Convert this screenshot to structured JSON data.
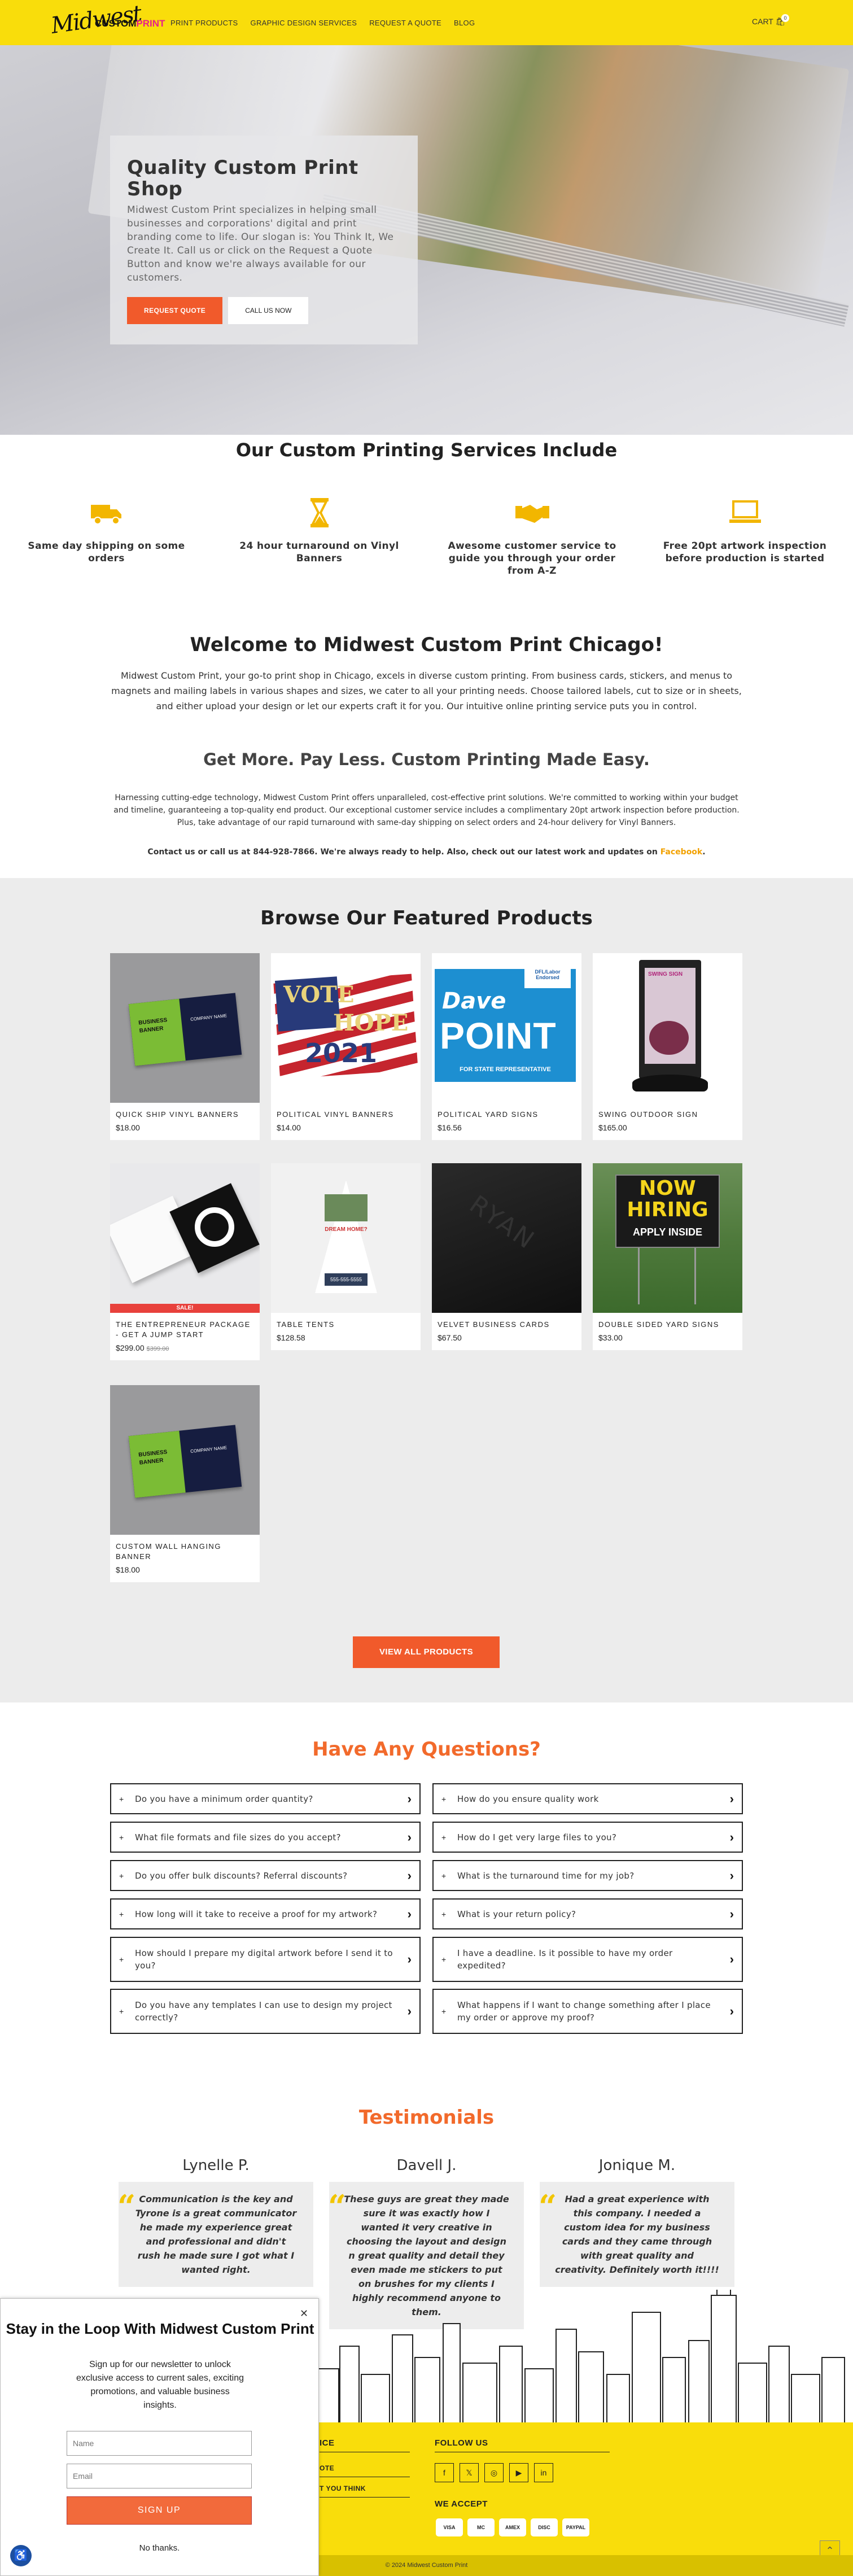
{
  "header": {
    "logo_script": "Midwest",
    "logo_name": "CUSTOM",
    "logo_accent": "PRINT",
    "nav": [
      "PRINT PRODUCTS",
      "GRAPHIC DESIGN SERVICES",
      "REQUEST A QUOTE",
      "BLOG"
    ],
    "cart_label": "CART",
    "cart_count": "0"
  },
  "hero": {
    "title": "Quality Custom Print Shop",
    "text": "Midwest Custom Print specializes in helping small businesses and corporations' digital and print branding come to life. Our slogan is: You Think It, We Create It. Call us or click on the Request a Quote Button and know we're always available for our customers.",
    "btn_quote": "REQUEST QUOTE",
    "btn_call": "CALL US NOW"
  },
  "services": {
    "title": "Our Custom Printing Services Include",
    "items": [
      {
        "icon": "truck-icon",
        "text": "Same day shipping on some orders"
      },
      {
        "icon": "hourglass-icon",
        "text": "24 hour turnaround on Vinyl Banners"
      },
      {
        "icon": "handshake-icon",
        "text": "Awesome customer service to guide you through your order from A-Z"
      },
      {
        "icon": "laptop-icon",
        "text": "Free 20pt artwork inspection before production is started"
      }
    ]
  },
  "welcome": {
    "title": "Welcome to Midwest Custom Print Chicago!",
    "text": "Midwest Custom Print, your go-to print shop in Chicago, excels in diverse custom printing. From business cards, stickers, and menus to magnets and mailing labels in various shapes and sizes, we cater to all your printing needs. Choose tailored labels, cut to size or in sheets, and either upload your design or let our experts craft it for you. Our intuitive online printing service puts you in control.",
    "subtitle": "Get More. Pay Less. Custom Printing Made Easy.",
    "text2": "Harnessing cutting-edge technology, Midwest Custom Print offers unparalleled, cost-effective print solutions. We're committed to working within your budget and timeline, guaranteeing a top-quality end product. Our exceptional customer service includes a complimentary 20pt artwork inspection before production. Plus, take advantage of our rapid turnaround with same-day shipping on select orders and 24-hour delivery for Vinyl Banners.",
    "contact": "Contact us or call us at 844-928-7866. We're always ready to help. Also, check out our latest work and updates on",
    "facebook": "Facebook",
    "period": "."
  },
  "products": {
    "title": "Browse Our Featured Products",
    "view_all": "VIEW ALL PRODUCTS",
    "items": [
      {
        "name": "QUICK SHIP VINYL BANNERS",
        "price": "$18.00",
        "old": ""
      },
      {
        "name": "POLITICAL VINYL BANNERS",
        "price": "$14.00",
        "old": ""
      },
      {
        "name": "POLITICAL YARD SIGNS",
        "price": "$16.56",
        "old": ""
      },
      {
        "name": "SWING OUTDOOR SIGN",
        "price": "$165.00",
        "old": ""
      },
      {
        "name": "THE ENTREPRENEUR PACKAGE - GET A JUMP START",
        "price": "$299.00",
        "old": "$399.00"
      },
      {
        "name": "TABLE TENTS",
        "price": "$128.58",
        "old": ""
      },
      {
        "name": "VELVET BUSINESS CARDS",
        "price": "$67.50",
        "old": ""
      },
      {
        "name": "DOUBLE SIDED YARD SIGNS",
        "price": "$33.00",
        "old": ""
      },
      {
        "name": "CUSTOM WALL HANGING BANNER",
        "price": "$18.00",
        "old": ""
      }
    ],
    "sale_label": "SALE!",
    "img_text": {
      "banner_business": "BUSINESS",
      "banner_banner": "BANNER",
      "banner_company": "COMPANY NAME",
      "vote": "VOTE",
      "hope": "HOPE",
      "year": "2021",
      "dave": "Dave",
      "point": "POINT",
      "state_rep": "FOR STATE REPRESENTATIVE",
      "dfl": "DFL/Labor Endorsed",
      "swing": "SWING SIGN",
      "velvet": "RYAN",
      "now_hiring": "NOW HIRING",
      "apply": "APPLY INSIDE",
      "tent_head": "DREAM HOME?",
      "tent_phone": "555-555-5555"
    }
  },
  "faq": {
    "title": "Have Any Questions?",
    "left": [
      "Do you have a minimum order quantity?",
      "What file formats and file sizes do you accept?",
      "Do you offer bulk discounts? Referral discounts?",
      "How long will it take to receive a proof for my artwork?",
      "How should I prepare my digital artwork before I send it to you?",
      "Do you have any templates I can use to design my project correctly?"
    ],
    "right": [
      "How do you ensure quality work",
      "How do I get very large files to you?",
      "What is the turnaround time for my job?",
      "What is your return policy?",
      "I have a deadline. Is it possible to have my order expedited?",
      "What happens if I want to change something after I place my order or approve my proof?"
    ]
  },
  "testimonials": {
    "title": "Testimonials",
    "items": [
      {
        "name": "Lynelle P.",
        "text": "Communication is the key and Tyrone is a great communicator he made my experience great and professional and didn't rush he made sure I got what I wanted right."
      },
      {
        "name": "Davell J.",
        "text": "These guys are great they made sure it was exactly how I wanted it very creative in choosing the layout and design n great quality and detail they even made me stickers to put on brushes for my clients I highly recommend anyone to them."
      },
      {
        "name": "Jonique M.",
        "text": "Had a great experience with this company. I needed a custom idea for my business cards and they came through with great quality and creativity. Definitely worth it!!!!"
      }
    ]
  },
  "footer": {
    "col_service_fragment": "ICE",
    "link1": "OTE",
    "link2": "T YOU THINK",
    "follow": "FOLLOW US",
    "accept": "WE ACCEPT",
    "social": [
      "f",
      "𝕏",
      "◎",
      "▶",
      "in"
    ],
    "pay": [
      "VISA",
      "MC",
      "AMEX",
      "DISC",
      "PAYPAL"
    ],
    "copyright": "© 2024 Midwest Custom Print"
  },
  "popup": {
    "title": "Stay in the Loop With Midwest Custom Print",
    "text": "Sign up for our newsletter to unlock exclusive access to current sales, exciting promotions, and valuable business insights.",
    "name_placeholder": "Name",
    "email_placeholder": "Email",
    "signup": "SIGN UP",
    "no_thanks": "No thanks."
  },
  "colors": {
    "brand_yellow": "#f9dd0b",
    "accent_orange": "#f15a2b"
  }
}
